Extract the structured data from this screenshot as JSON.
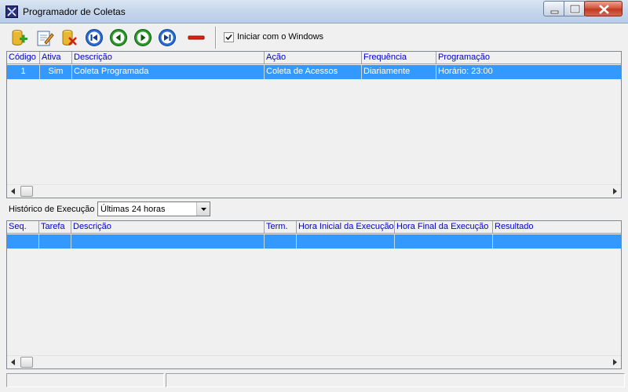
{
  "window": {
    "title": "Programador de Coletas"
  },
  "toolbar": {
    "buttons": [
      {
        "name": "add-icon"
      },
      {
        "name": "edit-icon"
      },
      {
        "name": "delete-icon"
      },
      {
        "name": "first-icon"
      },
      {
        "name": "previous-icon"
      },
      {
        "name": "next-icon"
      },
      {
        "name": "last-icon"
      },
      {
        "name": "remove-icon"
      }
    ],
    "start_with_windows_label": "Iniciar com o Windows",
    "start_with_windows_checked": true
  },
  "schedules": {
    "columns": [
      "Código",
      "Ativa",
      "Descrição",
      "Ação",
      "Frequência",
      "Programação"
    ],
    "rows": [
      {
        "codigo": "1",
        "ativa": "Sim",
        "descricao": "Coleta Programada",
        "acao": "Coleta de Acessos",
        "frequencia": "Diariamente",
        "programacao": "Horário: 23:00"
      }
    ]
  },
  "history": {
    "label": "Histórico de Execução",
    "filter_value": "Últimas 24 horas",
    "columns": [
      "Seq.",
      "Tarefa",
      "Descrição",
      "Term.",
      "Hora Inicial da Execução",
      "Hora Final da Execução",
      "Resultado"
    ]
  },
  "colors": {
    "selection": "#3399ff",
    "header_text": "#0000cc"
  }
}
